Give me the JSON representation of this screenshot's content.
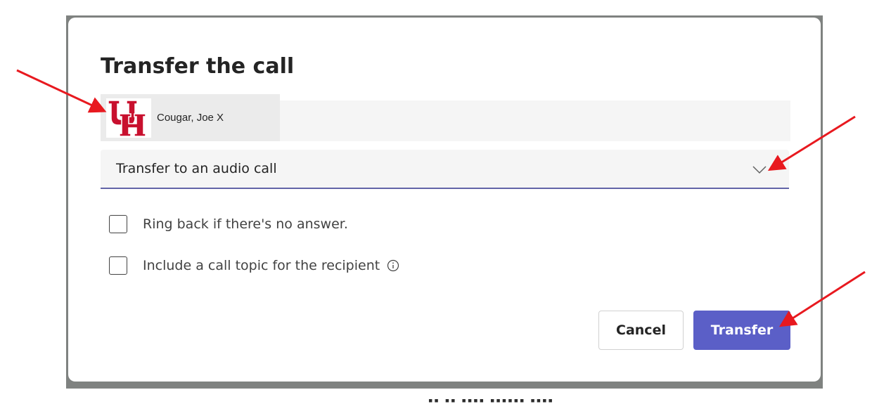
{
  "dialog": {
    "title": "Transfer the call",
    "recipient": {
      "name": "Cougar, Joe X",
      "avatar_icon": "uh-logo-icon"
    },
    "transfer_type": {
      "selected": "Transfer to an audio call",
      "icon": "chevron-down-icon"
    },
    "options": [
      {
        "label": "Ring back if there's no answer.",
        "checked": false
      },
      {
        "label": "Include a call topic for the recipient",
        "checked": false,
        "icon": "info-icon"
      }
    ],
    "buttons": {
      "cancel": "Cancel",
      "transfer": "Transfer"
    }
  },
  "colors": {
    "accent": "#5b5fc7",
    "annotation_arrow": "#e8191f",
    "logo_red": "#c8102e"
  }
}
